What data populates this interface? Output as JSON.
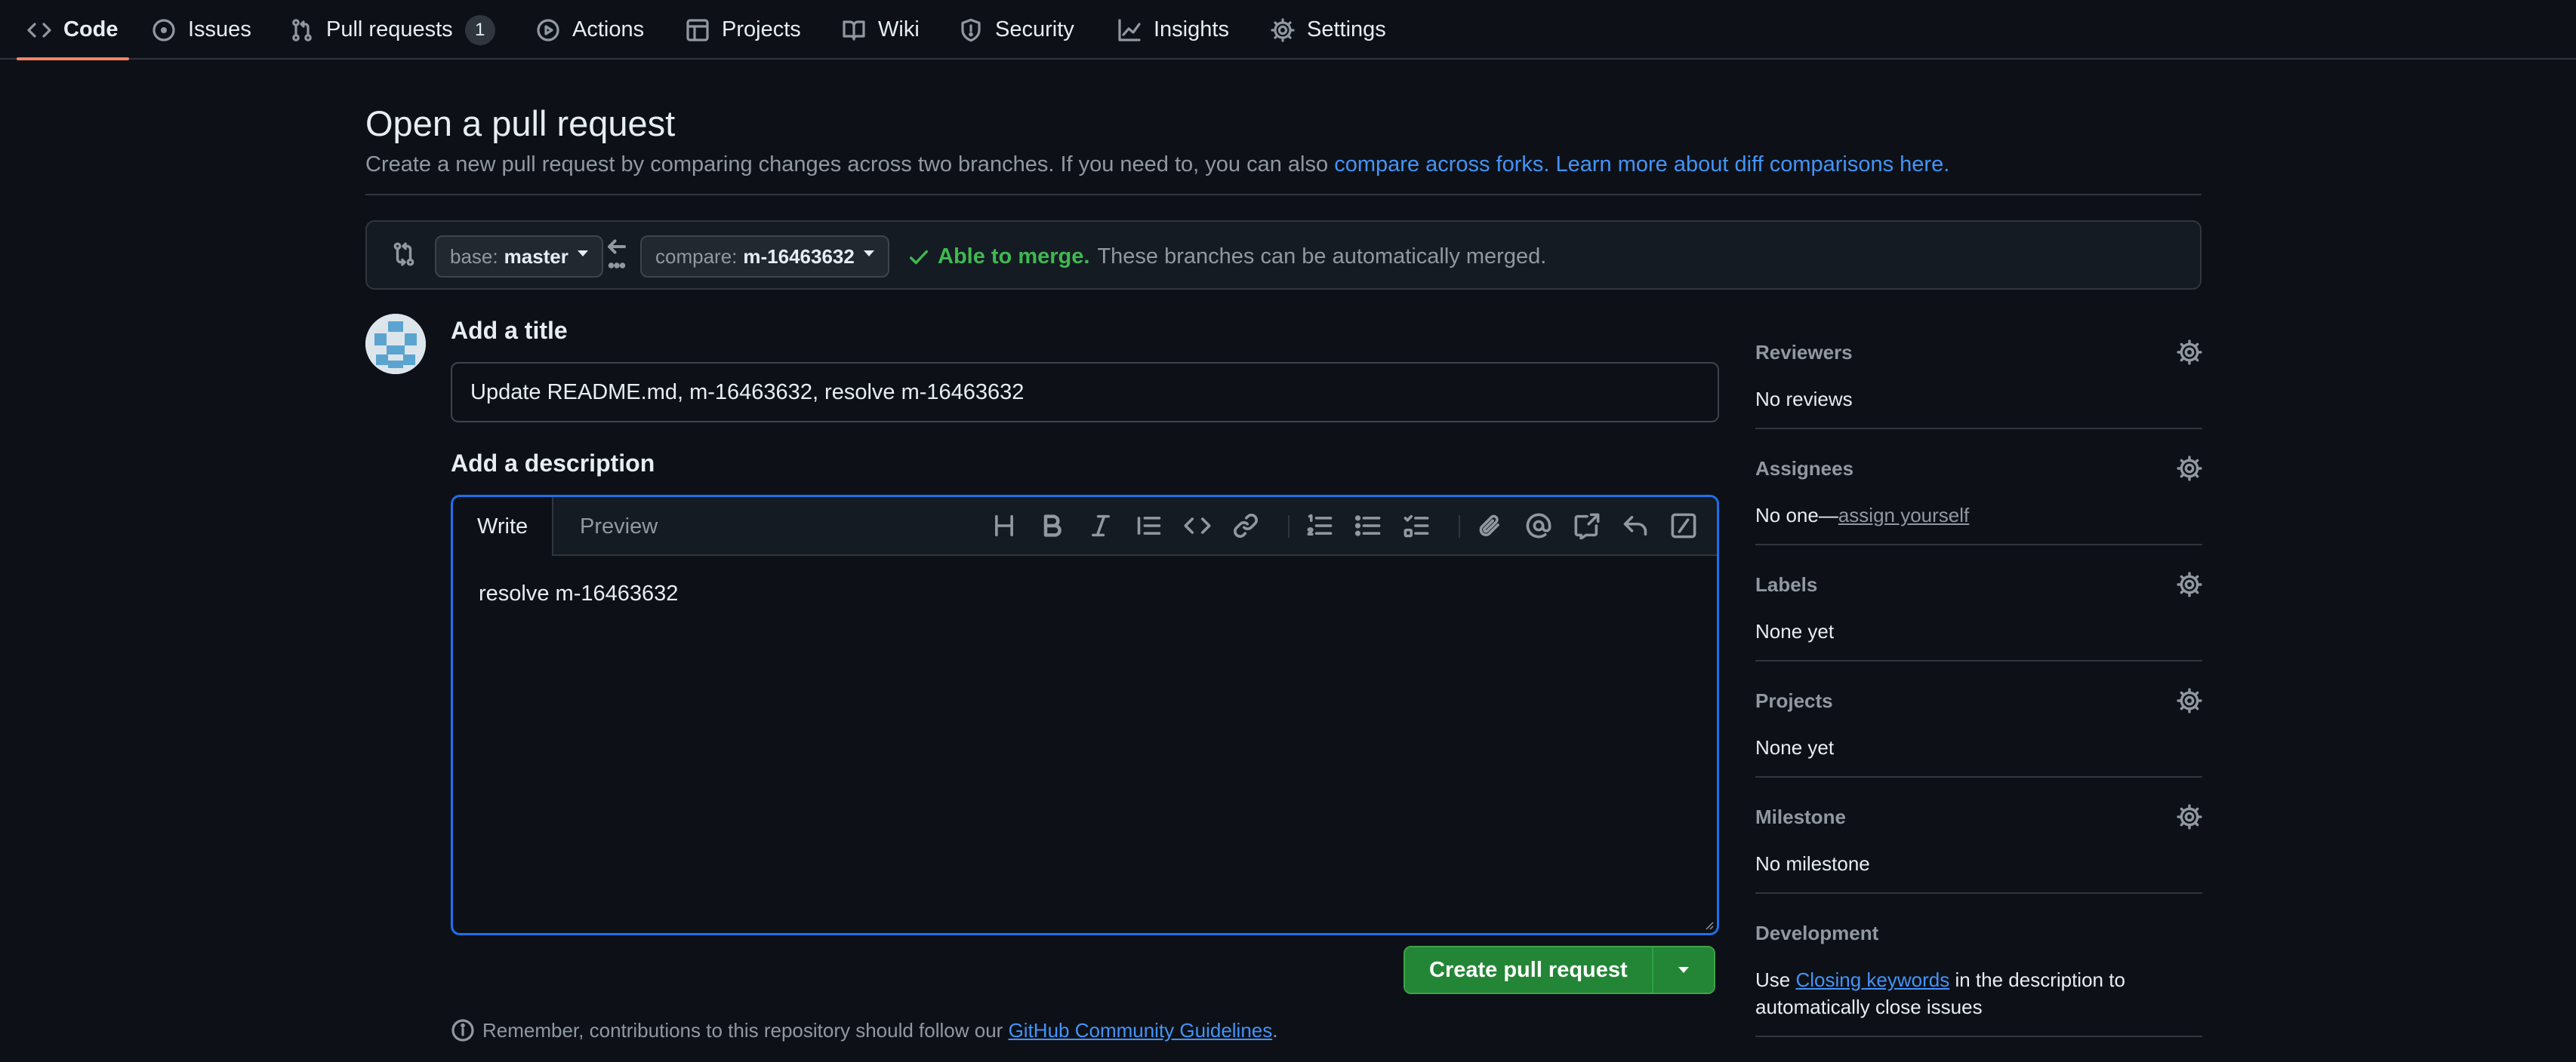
{
  "nav": {
    "tabs": [
      {
        "label": "Code",
        "icon": "code-icon"
      },
      {
        "label": "Issues",
        "icon": "issue-opened-icon"
      },
      {
        "label": "Pull requests",
        "icon": "git-pull-request-icon",
        "counter": "1"
      },
      {
        "label": "Actions",
        "icon": "play-icon"
      },
      {
        "label": "Projects",
        "icon": "table-icon"
      },
      {
        "label": "Wiki",
        "icon": "book-icon"
      },
      {
        "label": "Security",
        "icon": "shield-icon"
      },
      {
        "label": "Insights",
        "icon": "graph-icon"
      },
      {
        "label": "Settings",
        "icon": "gear-icon"
      }
    ],
    "selected": "Code"
  },
  "header": {
    "title": "Open a pull request",
    "subtitle_text": "Create a new pull request by comparing changes across two branches. If you need to, you can also ",
    "compare_forks_link": "compare across forks.",
    "learn_more_link": "Learn more about diff comparisons here."
  },
  "compare": {
    "base_prefix": "base:",
    "base_branch": "master",
    "compare_prefix": "compare:",
    "compare_branch": "m-16463632",
    "status_ok": "Able to merge.",
    "status_text": "These branches can be automatically merged."
  },
  "form": {
    "title_label": "Add a title",
    "title_value": "Update README.md, m-16463632, resolve m-16463632",
    "description_label": "Add a description",
    "write_tab": "Write",
    "preview_tab": "Preview",
    "description_value": "resolve m-16463632",
    "submit_label": "Create pull request"
  },
  "footer": {
    "remember_text": "Remember, contributions to this repository should follow our ",
    "guidelines_link": "GitHub Community Guidelines",
    "period": "."
  },
  "sidebar": {
    "reviewers": {
      "heading": "Reviewers",
      "value": "No reviews"
    },
    "assignees": {
      "heading": "Assignees",
      "value": "No one—",
      "link": "assign yourself"
    },
    "labels": {
      "heading": "Labels",
      "value": "None yet"
    },
    "projects": {
      "heading": "Projects",
      "value": "None yet"
    },
    "milestone": {
      "heading": "Milestone",
      "value": "No milestone"
    },
    "development": {
      "heading": "Development",
      "prefix": "Use ",
      "link": "Closing keywords",
      "suffix": " in the description to automatically close issues"
    }
  },
  "colors": {
    "background": "#0d1117",
    "accent_blue": "#4493f8",
    "success_green": "#3fb950",
    "button_green": "#238636",
    "tab_underline": "#f78166"
  }
}
